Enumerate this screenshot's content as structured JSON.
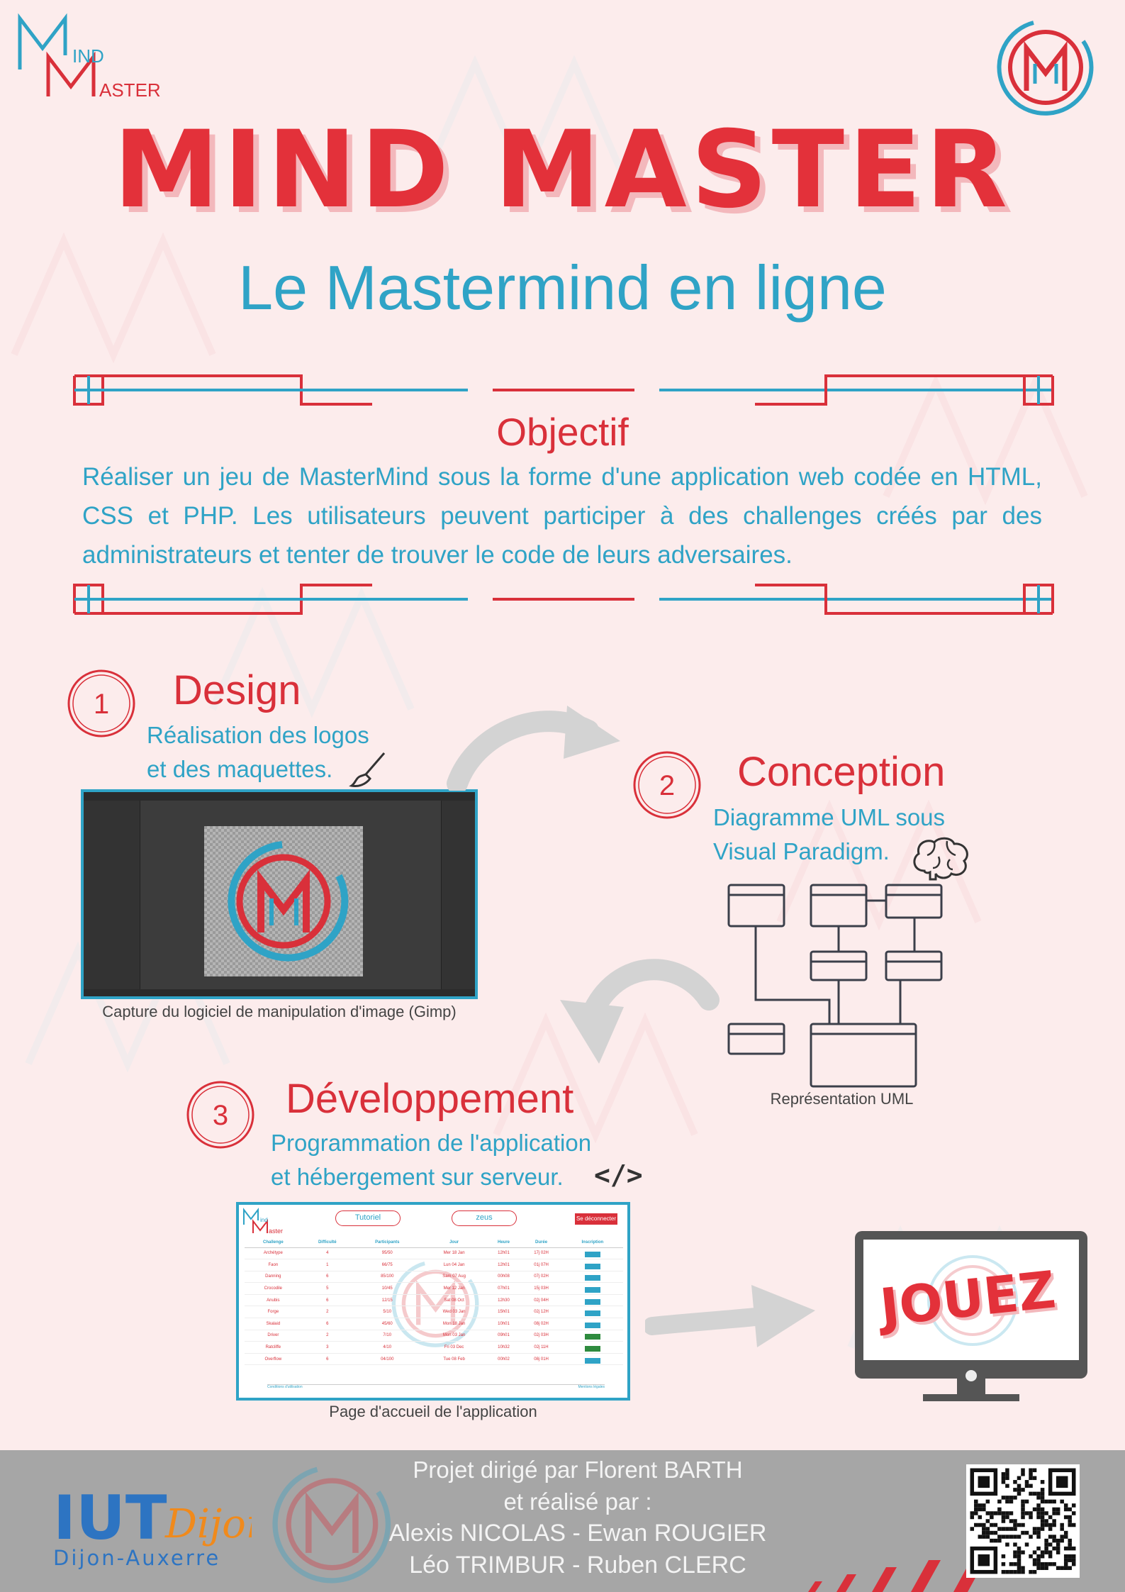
{
  "brand": {
    "logo_line1": "IND",
    "logo_line2": "ASTER",
    "title": "MIND MASTER",
    "subtitle": "Le Mastermind en ligne"
  },
  "objective": {
    "title": "Objectif",
    "text": "Réaliser un jeu de MasterMind sous la forme d'une application web codée en HTML, CSS et PHP. Les utilisateurs peuvent participer à des challenges créés par des administrateurs et tenter de trouver le code de leurs adversaires."
  },
  "steps": [
    {
      "number": "1",
      "title": "Design",
      "line1": "Réalisation des logos",
      "line2": "et des maquettes.",
      "icon": "brush-icon",
      "caption": "Capture du logiciel de manipulation d'image (Gimp)"
    },
    {
      "number": "2",
      "title": "Conception",
      "line1": "Diagramme UML sous",
      "line2": "Visual Paradigm.",
      "icon": "brain-icon",
      "caption": "Représentation UML"
    },
    {
      "number": "3",
      "title": "Développement",
      "line1": "Programmation de l'application",
      "line2": "et hébergement sur serveur.",
      "icon": "code-icon",
      "code_glyph": "</>",
      "caption": "Page d'accueil de l'application"
    }
  ],
  "app_screen": {
    "logo_line1": "ind",
    "logo_line2": "aster",
    "btn_tutorial": "Tutoriel",
    "btn_user": "zeus",
    "btn_logout": "Se déconnecter",
    "headers": [
      "Challenge",
      "Difficulté",
      "Participants",
      "Jour",
      "Heure",
      "Durée",
      "Inscription"
    ],
    "rows": [
      [
        "Archétype",
        "4",
        "95/50",
        "Mer 18 Jan",
        "12h01",
        "17j 02H",
        "Inscrire"
      ],
      [
        "Faon",
        "1",
        "66/75",
        "Lun 04 Jan",
        "12h01",
        "01j 07H",
        "Inscrire"
      ],
      [
        "Danning",
        "6",
        "85/100",
        "Sam 07 Aug",
        "00h08",
        "07j 02H",
        "Inscrire"
      ],
      [
        "Crocodile",
        "5",
        "10/45",
        "Mer 12 Jan",
        "07h01",
        "15j 03H",
        "Inscrire"
      ],
      [
        "Anubis",
        "6",
        "12/15",
        "Sat 08 Oct",
        "12h30",
        "02j 04H",
        "Inscrire"
      ],
      [
        "Forge",
        "2",
        "5/10",
        "Wed 03 Jan",
        "15h01",
        "02j 12H",
        "Inscrire"
      ],
      [
        "Skalaid",
        "6",
        "45/60",
        "Mon 18 Jan",
        "10h01",
        "08j 02H",
        "Inscrire"
      ],
      [
        "Driver",
        "2",
        "7/10",
        "Mon 03 Jan",
        "09h01",
        "02j 03H",
        "Inscrit"
      ],
      [
        "Ratcliffe",
        "3",
        "4/10",
        "Fri 03 Dec",
        "10h32",
        "02j 11H",
        "Inscrit"
      ],
      [
        "Overflow",
        "6",
        "04/100",
        "Tue 08 Feb",
        "00h02",
        "08j 01H",
        "Inscrire"
      ]
    ],
    "footer_left": "Conditions d'utilisation",
    "footer_right": "Mentions légales"
  },
  "play": {
    "label": "JOUEZ"
  },
  "footer": {
    "line1": "Projet dirigé par Florent BARTH",
    "line2": "et réalisé par :",
    "line3": "Alexis NICOLAS - Ewan ROUGIER",
    "line4": "Léo TRIMBUR - Ruben CLERC",
    "iut_name": "IUT",
    "iut_city": "Dijon",
    "iut_sub": "Dijon-Auxerre"
  },
  "colors": {
    "red": "#d9303a",
    "blue": "#2fa3c6",
    "background": "#fcecec",
    "footer": "#a6a6a6"
  }
}
